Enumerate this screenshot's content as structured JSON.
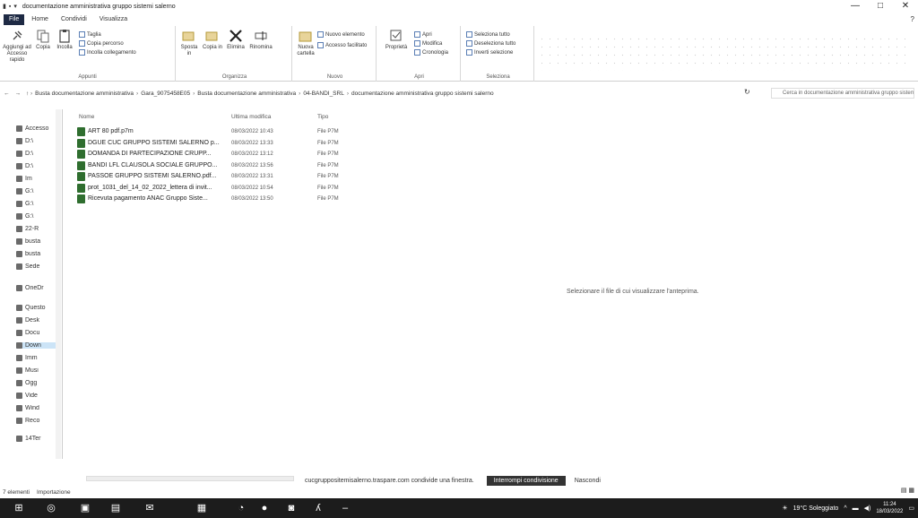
{
  "window": {
    "title": "documentazione amministrativa gruppo sistemi salerno",
    "controls": [
      "—",
      "□",
      "✕"
    ]
  },
  "ribbon_tabs": [
    "File",
    "Home",
    "Condividi",
    "Visualizza"
  ],
  "ribbon": {
    "groups": [
      {
        "name": "Appunti"
      },
      {
        "name": "Organizza"
      },
      {
        "name": "Nuovo"
      },
      {
        "name": "Apri"
      },
      {
        "name": "Seleziona"
      }
    ],
    "buttons": {
      "pin": "Aggiungi ad Accesso rapido",
      "copy": "Copia",
      "paste": "Incolla",
      "cut": "Taglia",
      "copy_path": "Copia percorso",
      "paste_shortcut": "Incolla collegamento",
      "move_to": "Sposta in",
      "copy_to": "Copia in",
      "delete": "Elimina",
      "rename": "Rinomina",
      "new_folder": "Nuova cartella",
      "new_item": "Nuovo elemento",
      "easy_access": "Accesso facilitato",
      "properties": "Proprietà",
      "open": "Apri",
      "edit": "Modifica",
      "history": "Cronologia",
      "select_all": "Seleziona tutto",
      "select_none": "Deseleziona tutto",
      "invert": "Inverti selezione"
    }
  },
  "address": {
    "crumbs": [
      "Busta documentazione amministrativa",
      "Gara_9075458E05",
      "Busta documentazione amministrativa",
      "04-BANDI_SRL",
      "documentazione amministrativa gruppo sistemi salerno"
    ],
    "search_placeholder": "Cerca in documentazione amministrativa gruppo sistemi salerno"
  },
  "navpane": {
    "items": [
      "Accesso",
      "D:\\",
      "D:\\",
      "D:\\",
      "Im",
      "G:\\",
      "G:\\",
      "G:\\",
      "22-R",
      "busta",
      "busta",
      "Sede",
      "OneDr",
      "Questo",
      "Desk",
      "Docu",
      "Down",
      "Imm",
      "Musi",
      "Ogg",
      "Vide",
      "Wind",
      "Reco",
      "14Ter"
    ],
    "selected_index": 16
  },
  "filelist": {
    "columns": {
      "name": "Nome",
      "date": "Ultima modifica",
      "type": "Tipo"
    },
    "rows": [
      {
        "name": "ART 80 pdf.p7m",
        "date": "08/03/2022 10:43",
        "type": "File P7M"
      },
      {
        "name": "DGUE CUC GRUPPO SISTEMI SALERNO p...",
        "date": "08/03/2022 13:33",
        "type": "File P7M"
      },
      {
        "name": "DOMANDA DI PARTECIPAZIONE CRUPP...",
        "date": "08/03/2022 13:12",
        "type": "File P7M"
      },
      {
        "name": "BANDI LFL CLAUSOLA SOCIALE GRUPPO...",
        "date": "08/03/2022 13:56",
        "type": "File P7M"
      },
      {
        "name": "PASSOE GRUPPO SISTEMI SALERNO.pdf...",
        "date": "08/03/2022 13:31",
        "type": "File P7M"
      },
      {
        "name": "prot_1031_del_14_02_2022_lettera di invit...",
        "date": "08/03/2022 10:54",
        "type": "File P7M"
      },
      {
        "name": "Ricevuta pagamento ANAC Gruppo Siste...",
        "date": "08/03/2022 13:50",
        "type": "File P7M"
      }
    ]
  },
  "preview_message": "Selezionare il file di cui visualizzare l'anteprima.",
  "notification": {
    "message": "cucgruppositemisalerno.traspare.com condivide una finestra.",
    "primary": "Interrompi condivisione",
    "secondary": "Nascondi"
  },
  "status": {
    "count": "7 elementi",
    "importing": "Importazione"
  },
  "taskbar": {
    "weather": "19°C Soleggiato",
    "time": "11:24",
    "date": "18/03/2022"
  }
}
